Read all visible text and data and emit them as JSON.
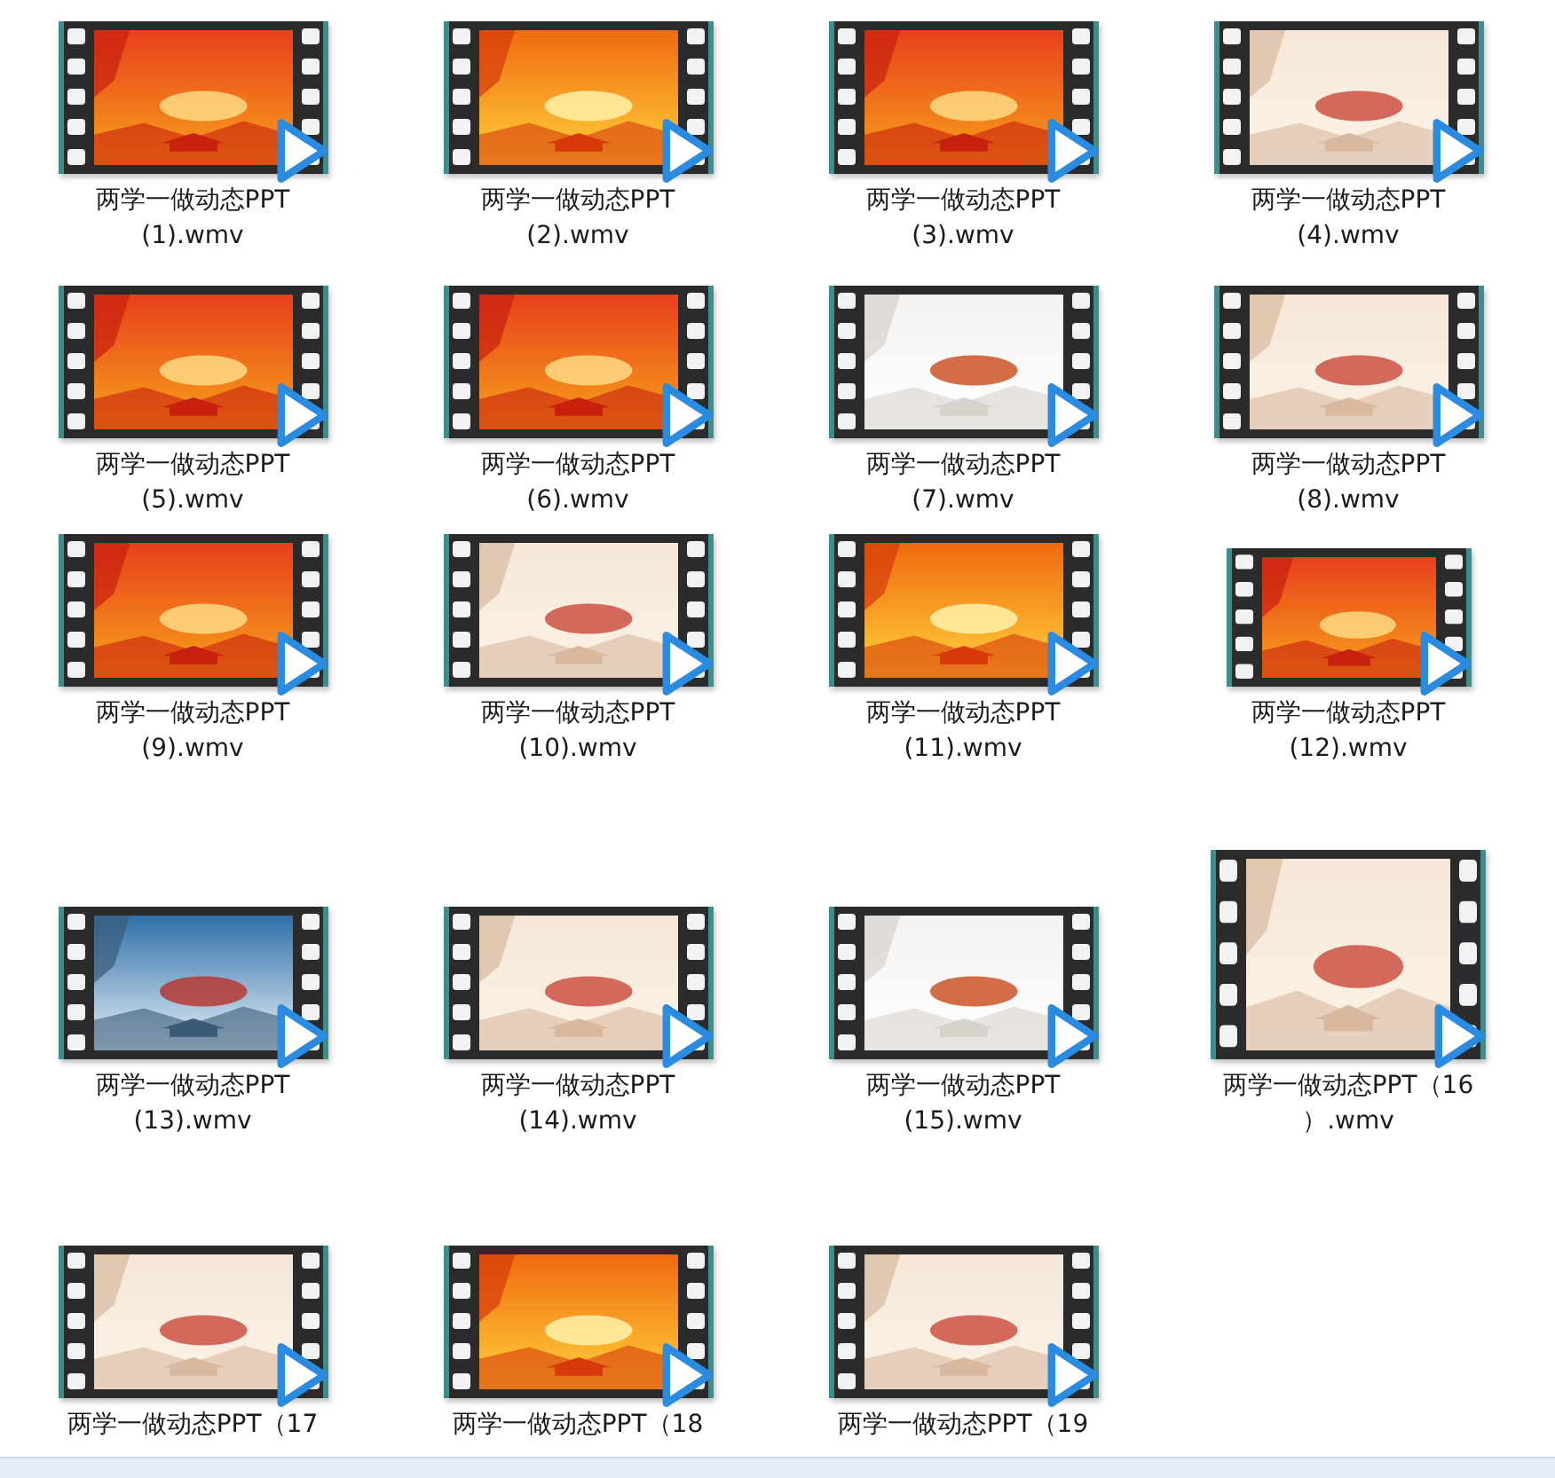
{
  "files": [
    {
      "kind": "wide",
      "lines": [
        "两学一做动态PPT",
        "(1).wmv"
      ]
    },
    {
      "kind": "wide",
      "lines": [
        "两学一做动态PPT",
        "(2).wmv"
      ]
    },
    {
      "kind": "wide",
      "lines": [
        "两学一做动态PPT",
        "(3).wmv"
      ]
    },
    {
      "kind": "wide",
      "lines": [
        "两学一做动态PPT",
        "(4).wmv"
      ]
    },
    {
      "kind": "wide",
      "lines": [
        "两学一做动态PPT",
        "(5).wmv"
      ]
    },
    {
      "kind": "wide",
      "lines": [
        "两学一做动态PPT",
        "(6).wmv"
      ]
    },
    {
      "kind": "wide",
      "lines": [
        "两学一做动态PPT",
        "(7).wmv"
      ]
    },
    {
      "kind": "wide",
      "lines": [
        "两学一做动态PPT",
        "(8).wmv"
      ]
    },
    {
      "kind": "wide",
      "lines": [
        "两学一做动态PPT",
        "(9).wmv"
      ]
    },
    {
      "kind": "wide",
      "lines": [
        "两学一做动态PPT",
        "(10).wmv"
      ]
    },
    {
      "kind": "wide",
      "lines": [
        "两学一做动态PPT",
        "(11).wmv"
      ]
    },
    {
      "kind": "small",
      "lines": [
        "两学一做动态PPT",
        "(12).wmv"
      ]
    },
    {
      "kind": "wide",
      "lines": [
        "两学一做动态PPT",
        "(13).wmv"
      ]
    },
    {
      "kind": "wide",
      "lines": [
        "两学一做动态PPT",
        "(14).wmv"
      ]
    },
    {
      "kind": "wide",
      "lines": [
        "两学一做动态PPT",
        "(15).wmv"
      ]
    },
    {
      "kind": "tall",
      "lines": [
        "两学一做动态PPT（16",
        "）.wmv"
      ]
    },
    {
      "kind": "wide",
      "lines": [
        "两学一做动态PPT（17"
      ]
    },
    {
      "kind": "wide",
      "lines": [
        "两学一做动态PPT（18"
      ]
    },
    {
      "kind": "wide",
      "lines": [
        "两学一做动态PPT（19"
      ]
    }
  ]
}
